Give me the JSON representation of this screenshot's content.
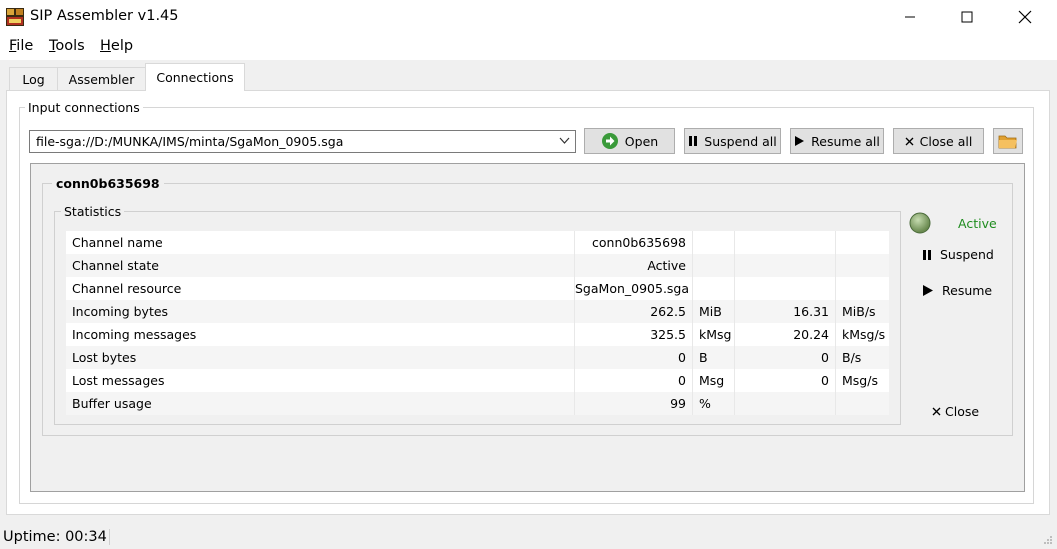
{
  "window": {
    "title": "SIP Assembler v1.45"
  },
  "menu": {
    "file": "File",
    "tools": "Tools",
    "help": "Help"
  },
  "tabs": [
    {
      "label": "Log",
      "active": false
    },
    {
      "label": "Assembler",
      "active": false
    },
    {
      "label": "Connections",
      "active": true
    }
  ],
  "input_group": {
    "label": "Input connections"
  },
  "combo": {
    "value": "file-sga://D:/MUNKA/IMS/minta/SgaMon_0905.sga"
  },
  "toolbar": {
    "open": "Open",
    "suspend_all": "Suspend all",
    "resume_all": "Resume all",
    "close_all": "Close all"
  },
  "connection": {
    "name": "conn0b635698",
    "stats_label": "Statistics",
    "status": "Active",
    "status_color": "#1e8c1e",
    "suspend": "Suspend",
    "resume": "Resume",
    "close": "Close"
  },
  "stats": [
    [
      "Channel name",
      "conn0b635698",
      "",
      "",
      ""
    ],
    [
      "Channel state",
      "Active",
      "",
      "",
      ""
    ],
    [
      "Channel resource",
      "SgaMon_0905.sga",
      "",
      "",
      ""
    ],
    [
      "Incoming bytes",
      "262.5",
      "MiB",
      "16.31",
      "MiB/s"
    ],
    [
      "Incoming messages",
      "325.5",
      "kMsg",
      "20.24",
      "kMsg/s"
    ],
    [
      "Lost bytes",
      "0",
      "B",
      "0",
      "B/s"
    ],
    [
      "Lost messages",
      "0",
      "Msg",
      "0",
      "Msg/s"
    ],
    [
      "Buffer usage",
      "99",
      "%",
      "",
      ""
    ]
  ],
  "statusbar": {
    "uptime": "Uptime: 00:34"
  }
}
